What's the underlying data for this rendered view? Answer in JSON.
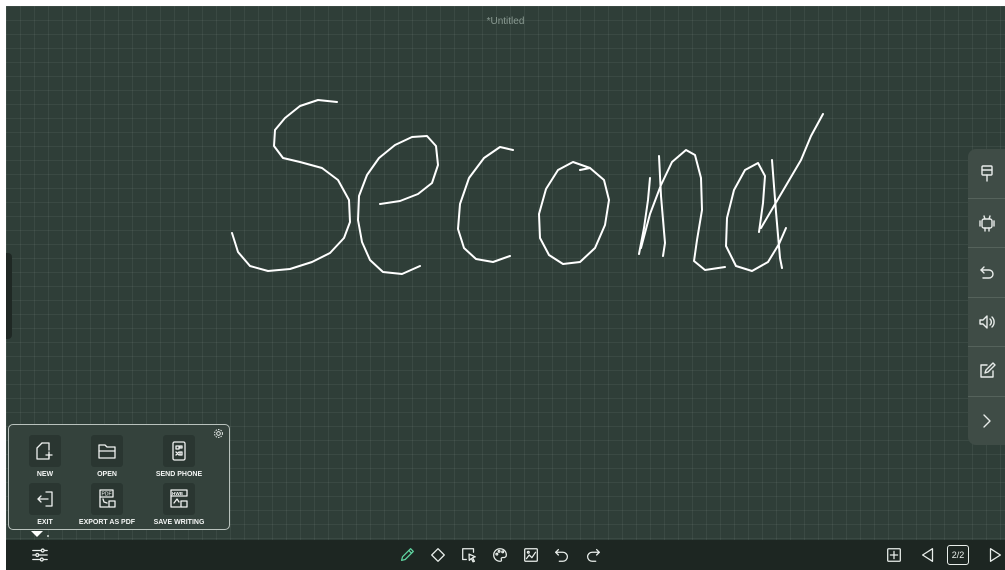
{
  "document": {
    "title": "*Untitled"
  },
  "side_panel": {
    "items": [
      {
        "icon": "pin-icon"
      },
      {
        "icon": "android-icon"
      },
      {
        "icon": "back-icon"
      },
      {
        "icon": "volume-icon"
      },
      {
        "icon": "annotate-icon"
      },
      {
        "icon": "chevron-right-icon"
      }
    ]
  },
  "file_menu": {
    "settings_icon": "gear-icon",
    "items": [
      {
        "label": "NEW",
        "icon": "new-file-icon"
      },
      {
        "label": "OPEN",
        "icon": "folder-icon"
      },
      {
        "label": "SEND PHONE",
        "icon": "qr-phone-icon"
      },
      {
        "label": "EXIT",
        "icon": "exit-icon"
      },
      {
        "label": "EXPORT AS PDF",
        "icon": "pdf-icon"
      },
      {
        "label": "SAVE WRITING",
        "icon": "hwb-icon"
      }
    ]
  },
  "toolbar": {
    "menu_icon": "sliders-icon",
    "tools": [
      "pen-icon",
      "eraser-icon",
      "select-icon",
      "palette-icon",
      "background-icon",
      "undo-icon",
      "redo-icon"
    ],
    "page_controls": {
      "add": "add-page-icon",
      "prev": "prev-page-icon",
      "page_indicator": "2/2",
      "next": "next-page-icon"
    }
  },
  "canvas": {
    "handwriting": "Second",
    "accent_color": "#2f3e38",
    "ink_color": "#ffffff"
  }
}
